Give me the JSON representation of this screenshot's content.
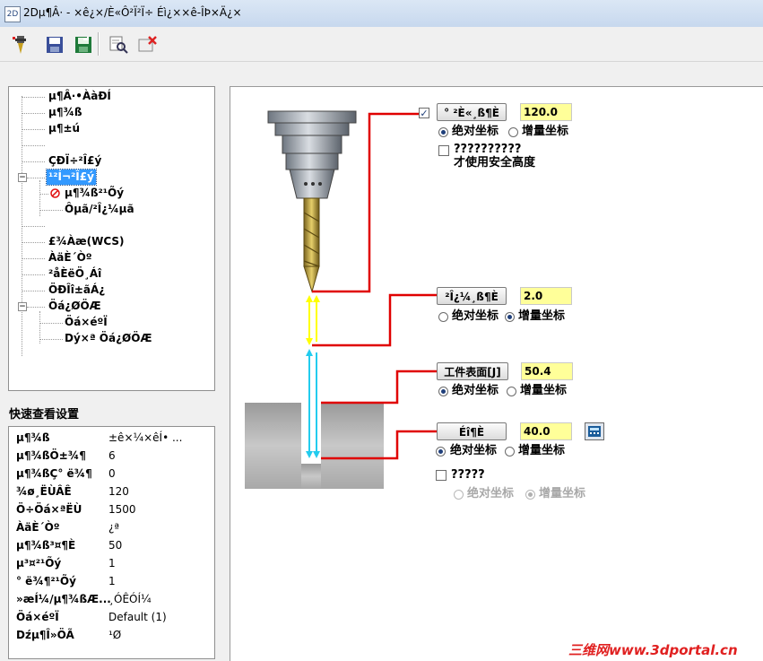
{
  "window": {
    "title": "2Dµ¶Â· - ×ê¿×/È«Ô²Ï²Ï÷ Éì¿××ê-ÎÞ×Ä¿×",
    "icon_text": "2D"
  },
  "toolbar": {
    "buttons": [
      "tool-icon",
      "save-icon",
      "save-as-icon",
      "preview-icon",
      "close-icon"
    ]
  },
  "tree": {
    "items": [
      {
        "label": "µ¶Â·•ÀàÐÍ"
      },
      {
        "label": "µ¶¾ß"
      },
      {
        "label": "µ¶±ú"
      },
      {
        "label": ""
      },
      {
        "label": "ÇÐÏ÷²Î£ý"
      },
      {
        "label": "¹²Í¬²Î£ý"
      },
      {
        "label": "µ¶¾ß²¹Õý"
      },
      {
        "label": "Ô­µã/²Î¿¼µã"
      },
      {
        "label": ""
      },
      {
        "label": "£¾Àæ(WCS)"
      },
      {
        "label": "ÀäÈ´Òº"
      },
      {
        "label": "²åÈëÖ¸Áî"
      },
      {
        "label": "ÖÐÎî±ãÁ¿"
      },
      {
        "label": "Öá¿ØÖÆ"
      },
      {
        "label": "Öá×éºÏ"
      },
      {
        "label": "Dý×ª Öá¿ØÖÆ"
      }
    ]
  },
  "quick_settings": {
    "title": "快速查看设置",
    "rows": [
      {
        "key": "µ¶¾ß",
        "value": "±ê×¼×êÍ• ..."
      },
      {
        "key": "µ¶¾ßÖ±¾¶",
        "value": "6"
      },
      {
        "key": "µ¶¾ßÇ° ë¾¶",
        "value": "0"
      },
      {
        "key": "¾ø¸ËÙÂÊ",
        "value": "120"
      },
      {
        "key": "Ö÷Öá×ªËÙ",
        "value": "1500"
      },
      {
        "key": "ÀäÈ´Òº",
        "value": "¿ª"
      },
      {
        "key": "µ¶¾ß³¤¶È",
        "value": "50"
      },
      {
        "key": "µ³¤²¹Õý",
        "value": "1"
      },
      {
        "key": "° ë¾¶²¹Õý",
        "value": "1"
      },
      {
        "key": "»æÍ¼/µ¶¾ßÆ...",
        "value": "¸ÓÊÓÍ¼"
      },
      {
        "key": "Öá×éºÏ",
        "value": "Default (1)"
      },
      {
        "key": "Dźµ¶Î»ÖÃ",
        "value": "¹Ø"
      }
    ]
  },
  "params": {
    "safety": {
      "checked": true,
      "button": "° ²È«¸ß¶È",
      "value": "120.0",
      "abs_label": "绝对坐标",
      "inc_label": "增量坐标",
      "selected": "abs"
    },
    "safety_option": {
      "checked": false,
      "line1": "??????????",
      "line2": "才使用安全高度"
    },
    "retract": {
      "button": "²Î¿¼¸ß¶È",
      "value": "2.0",
      "abs_label": "绝对坐标",
      "inc_label": "增量坐标",
      "selected": "inc"
    },
    "surface": {
      "button": "工件表面[J]",
      "value": "50.4",
      "abs_label": "绝对坐标",
      "inc_label": "增量坐标",
      "selected": "abs"
    },
    "depth": {
      "button": "Éî¶È",
      "value": "40.0",
      "abs_label": "绝对坐标",
      "inc_label": "增量坐标",
      "selected": "abs"
    },
    "extra": {
      "checked": false,
      "label": "?????",
      "abs_label": "绝对坐标",
      "inc_label": "增量坐标",
      "selected": "inc",
      "disabled": true
    }
  },
  "colors": {
    "yellow_field": "#ffff99",
    "guide_red": "#e00000",
    "arrow_yellow": "#ffff00",
    "arrow_cyan": "#22ccee",
    "selection": "#3399ff"
  },
  "watermark": "三维网www.3dportal.cn"
}
